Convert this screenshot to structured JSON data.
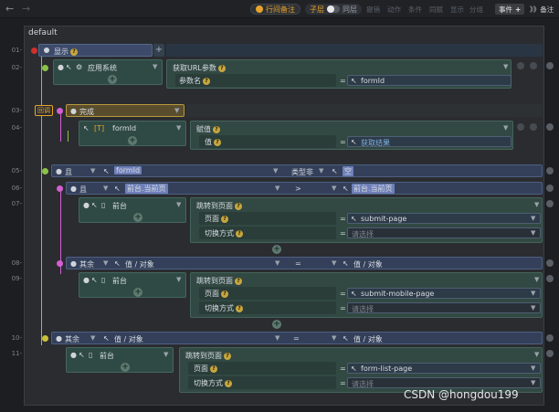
{
  "toolbar": {
    "line_note": "行间备注",
    "child_layer": "子层",
    "same_layer": "同层",
    "disabled_items": [
      "撤销",
      "动作",
      "条件",
      "同赋",
      "显示",
      "分组"
    ],
    "event_label": "事件",
    "event_plus": "+",
    "note_label": "备注",
    "note_prefix": "》》"
  },
  "canvas": {
    "title": "default"
  },
  "lines": [
    "01-",
    "02-",
    "03-",
    "04-",
    "05-",
    "06-",
    "07-",
    "08-",
    "09-",
    "10-",
    "11-"
  ],
  "tags": {
    "callback": "回调"
  },
  "row1": {
    "label": "显示",
    "plus": "+"
  },
  "row2": {
    "owner": "应用系统",
    "action": "获取URL参数",
    "param_label": "参数名",
    "eq": "=",
    "param_value": "formId"
  },
  "row3": {
    "label": "完成"
  },
  "row4": {
    "target": "formId",
    "action": "赋值",
    "value_label": "值",
    "eq": "=",
    "value": "获取结果"
  },
  "row5": {
    "label": "且",
    "subject": "formId",
    "op": "类型非",
    "value": "空"
  },
  "row6": {
    "label": "且",
    "left": "前台.当前页",
    "op": ">",
    "right": "前台.当前页"
  },
  "row7": {
    "owner": "前台",
    "action": "跳转到页面",
    "page_label": "页面",
    "page_value": "submit-page",
    "switch_label": "切换方式",
    "switch_value": "请选择",
    "eq": "="
  },
  "row8": {
    "label": "其余",
    "left": "值 / 对象",
    "op": "=",
    "right": "值 / 对象"
  },
  "row9": {
    "owner": "前台",
    "action": "跳转到页面",
    "page_label": "页面",
    "page_value": "submit-mobile-page",
    "switch_label": "切换方式",
    "switch_value": "请选择",
    "eq": "="
  },
  "row10": {
    "label": "其余",
    "left": "值 / 对象",
    "op": "=",
    "right": "值 / 对象"
  },
  "row11": {
    "owner": "前台",
    "action": "跳转到页面",
    "page_label": "页面",
    "page_value": "form-list-page",
    "switch_label": "切换方式",
    "switch_value": "请选择",
    "eq": "="
  },
  "watermark": "CSDN @hongdou199",
  "colors": {
    "accent_orange": "#e8a42a",
    "gutter_red": "#d0312d",
    "condition_green": "#8bc34a",
    "loop_pink": "#d45fd0",
    "yellow": "#c9c23a"
  },
  "icons": {
    "back": "arrow-left-icon",
    "forward": "arrow-right-icon",
    "cursor": "cursor-icon",
    "gear": "gear-icon",
    "phone": "phone-icon",
    "variable": "bracket-variable-icon"
  }
}
